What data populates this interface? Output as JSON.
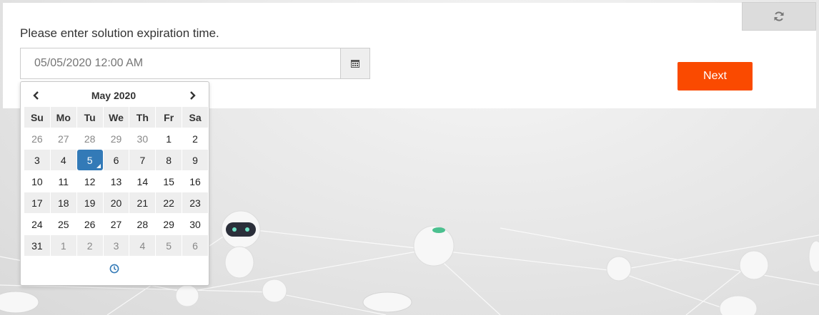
{
  "form": {
    "prompt": "Please enter solution expiration time.",
    "date_placeholder": "05/05/2020 12:00 AM",
    "next_label": "Next"
  },
  "icons": {
    "refresh": "refresh-icon",
    "calendar": "calendar-icon",
    "prev": "chevron-left-icon",
    "next": "chevron-right-icon",
    "clock": "clock-icon"
  },
  "colors": {
    "accent": "#fa4a00",
    "selected": "#337ab7"
  },
  "datepicker": {
    "month_label": "May 2020",
    "weekdays": [
      "Su",
      "Mo",
      "Tu",
      "We",
      "Th",
      "Fr",
      "Sa"
    ],
    "selected": "5",
    "weeks": [
      [
        {
          "d": "26",
          "old": true
        },
        {
          "d": "27",
          "old": true
        },
        {
          "d": "28",
          "old": true
        },
        {
          "d": "29",
          "old": true
        },
        {
          "d": "30",
          "old": true
        },
        {
          "d": "1"
        },
        {
          "d": "2"
        }
      ],
      [
        {
          "d": "3"
        },
        {
          "d": "4"
        },
        {
          "d": "5",
          "active": true
        },
        {
          "d": "6"
        },
        {
          "d": "7"
        },
        {
          "d": "8"
        },
        {
          "d": "9"
        }
      ],
      [
        {
          "d": "10"
        },
        {
          "d": "11"
        },
        {
          "d": "12"
        },
        {
          "d": "13"
        },
        {
          "d": "14"
        },
        {
          "d": "15"
        },
        {
          "d": "16"
        }
      ],
      [
        {
          "d": "17"
        },
        {
          "d": "18"
        },
        {
          "d": "19"
        },
        {
          "d": "20"
        },
        {
          "d": "21"
        },
        {
          "d": "22"
        },
        {
          "d": "23"
        }
      ],
      [
        {
          "d": "24"
        },
        {
          "d": "25"
        },
        {
          "d": "26"
        },
        {
          "d": "27"
        },
        {
          "d": "28"
        },
        {
          "d": "29"
        },
        {
          "d": "30"
        }
      ],
      [
        {
          "d": "31"
        },
        {
          "d": "1",
          "old": true
        },
        {
          "d": "2",
          "old": true
        },
        {
          "d": "3",
          "old": true
        },
        {
          "d": "4",
          "old": true
        },
        {
          "d": "5",
          "old": true
        },
        {
          "d": "6",
          "old": true
        }
      ]
    ]
  }
}
